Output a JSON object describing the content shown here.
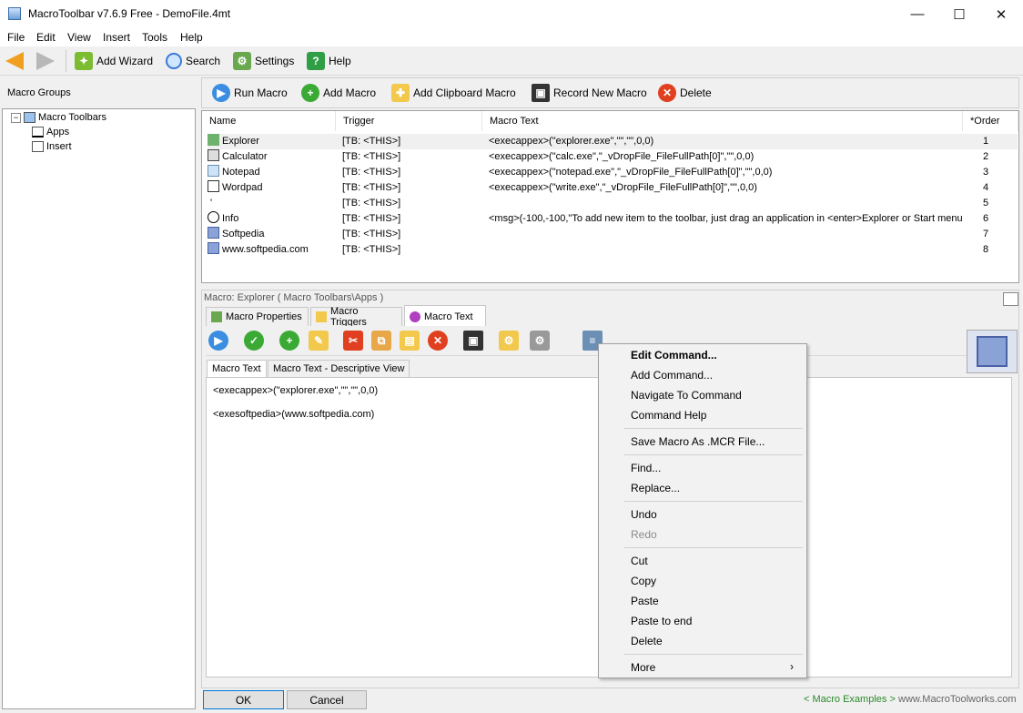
{
  "window": {
    "title": "MacroToolbar v7.6.9 Free - DemoFile.4mt",
    "minimize": "—",
    "maximize": "☐",
    "close": "✕"
  },
  "menubar": [
    "File",
    "Edit",
    "View",
    "Insert",
    "Tools",
    "Help"
  ],
  "toolbar": {
    "add_wizard": "Add Wizard",
    "search": "Search",
    "settings": "Settings",
    "help": "Help"
  },
  "left": {
    "header": "Macro Groups",
    "tree": {
      "root": "Macro Toolbars",
      "children": [
        "Apps",
        "Insert"
      ]
    }
  },
  "actions": {
    "run": "Run Macro",
    "add": "Add Macro",
    "add_clipboard": "Add Clipboard Macro",
    "record": "Record New Macro",
    "delete": "Delete"
  },
  "grid": {
    "columns": [
      "Name",
      "Trigger",
      "Macro Text",
      "*Order"
    ],
    "rows": [
      {
        "name": "Explorer",
        "trigger": "[TB: <THIS>]",
        "text": "<execappex>(\"explorer.exe\",\"\",\"\",0,0)",
        "order": "1",
        "icon": "explorer-icon"
      },
      {
        "name": "Calculator",
        "trigger": "[TB: <THIS>]",
        "text": "<execappex>(\"calc.exe\",\"_vDropFile_FileFullPath[0]\",\"\",0,0)",
        "order": "2",
        "icon": "calculator-icon"
      },
      {
        "name": "Notepad",
        "trigger": "[TB: <THIS>]",
        "text": "<execappex>(\"notepad.exe\",\"_vDropFile_FileFullPath[0]\",\"\",0,0)",
        "order": "3",
        "icon": "notepad-icon"
      },
      {
        "name": "Wordpad",
        "trigger": "[TB: <THIS>]",
        "text": "<execappex>(\"write.exe\",\"_vDropFile_FileFullPath[0]\",\"\",0,0)",
        "order": "4",
        "icon": "wordpad-icon"
      },
      {
        "name": "'",
        "trigger": "[TB: <THIS>]",
        "text": "",
        "order": "5",
        "icon": ""
      },
      {
        "name": "Info",
        "trigger": "[TB: <THIS>]",
        "text": "<msg>(-100,-100,\"To add new item to the toolbar, just drag an application in <enter>Explorer or Start menu ...",
        "order": "6",
        "icon": "info-icon"
      },
      {
        "name": "Softpedia",
        "trigger": "[TB: <THIS>]",
        "text": "",
        "order": "7",
        "icon": "cube-icon"
      },
      {
        "name": "www.softpedia.com",
        "trigger": "[TB: <THIS>]",
        "text": "",
        "order": "8",
        "icon": "cube-icon"
      }
    ]
  },
  "lower": {
    "caption": "Macro: Explorer ( Macro Toolbars\\Apps )",
    "tabs": [
      "Macro Properties",
      "Macro Triggers",
      "Macro Text"
    ],
    "subtabs": [
      "Macro Text",
      "Macro Text - Descriptive View"
    ],
    "code": [
      "<execappex>(\"explorer.exe\",\"\",\"\",0,0)",
      "<exesoftpedia>(www.softpedia.com)"
    ]
  },
  "context_menu": [
    "Edit Command...",
    "Add Command...",
    "Navigate To Command",
    "Command Help",
    "Save Macro As .MCR File...",
    "Find...",
    "Replace...",
    "Undo",
    "Redo",
    "Cut",
    "Copy",
    "Paste",
    "Paste to end",
    "Delete",
    "More"
  ],
  "buttons": {
    "ok": "OK",
    "cancel": "Cancel"
  },
  "footer": {
    "examples": "< Macro Examples >",
    "site": "www.MacroToolworks.com"
  },
  "colors": {
    "accent_blue": "#3a8de0",
    "accent_green": "#3aaa35",
    "accent_red": "#e0401f",
    "selection": "#f0f0f0"
  }
}
